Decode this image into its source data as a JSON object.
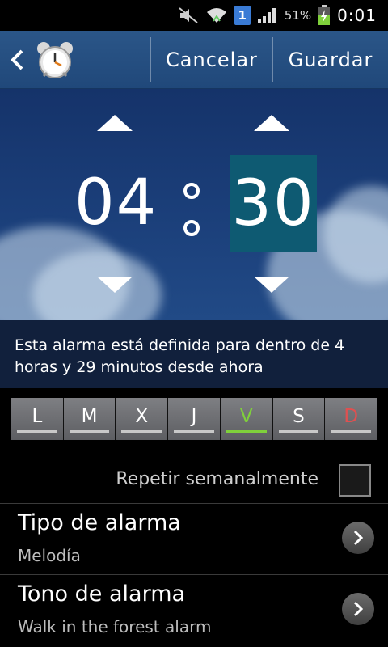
{
  "status_bar": {
    "battery_percent": "51%",
    "time": "0:01",
    "sim_badge": "1"
  },
  "action_bar": {
    "cancel_label": "Cancelar",
    "save_label": "Guardar",
    "app_icon": "alarm-clock-icon"
  },
  "picker": {
    "hours": "04",
    "minutes": "30",
    "selected_field": "minutes",
    "selected_color": "#0e5a72"
  },
  "info": {
    "text": "Esta alarma está definida para dentro de 4 horas y 29 minutos desde ahora"
  },
  "days": [
    {
      "label": "L",
      "active": false
    },
    {
      "label": "M",
      "active": false
    },
    {
      "label": "X",
      "active": false
    },
    {
      "label": "J",
      "active": false
    },
    {
      "label": "V",
      "active": true
    },
    {
      "label": "S",
      "active": false
    },
    {
      "label": "D",
      "active": false
    }
  ],
  "repeat": {
    "label": "Repetir semanalmente",
    "checked": false
  },
  "alarm_type": {
    "title": "Tipo de alarma",
    "value": "Melodía"
  },
  "alarm_tone": {
    "title": "Tono de alarma",
    "value": "Walk in the forest alarm"
  },
  "colors": {
    "accent_green": "#7fd03b",
    "sunday_red": "#e05050",
    "action_bar": "#20487a"
  }
}
